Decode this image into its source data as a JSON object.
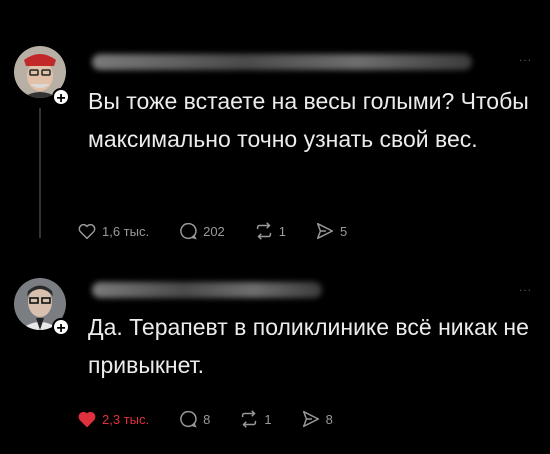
{
  "posts": [
    {
      "text": "Вы тоже встаете на весы голыми? Чтобы максимально точно узнать свой вес.",
      "more": "...",
      "actions": {
        "likes": "1,6 тыс.",
        "comments": "202",
        "reposts": "1",
        "shares": "5"
      },
      "liked": false
    },
    {
      "text": "Да. Терапевт в поликлинике всё никак не привыкнет.",
      "more": "...",
      "actions": {
        "likes": "2,3 тыс.",
        "comments": "8",
        "reposts": "1",
        "shares": "8"
      },
      "liked": true
    }
  ],
  "colors": {
    "background": "#000000",
    "text": "#ececec",
    "muted": "#9a9a9a",
    "like_active": "#e0303e"
  }
}
